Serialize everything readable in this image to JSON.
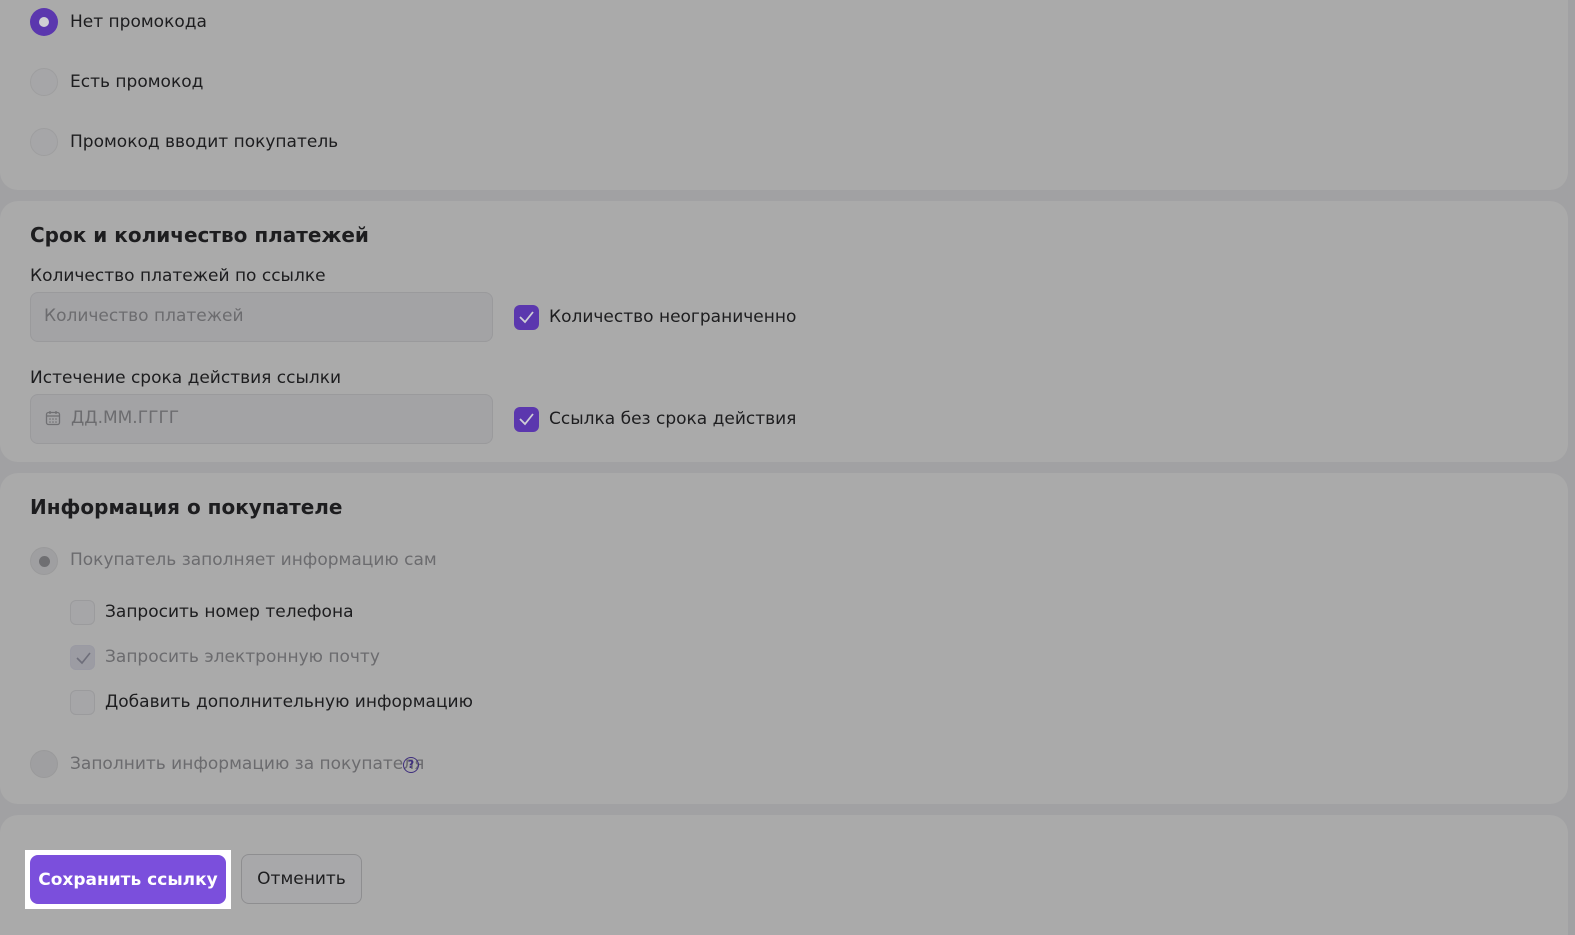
{
  "promo": {
    "options": [
      {
        "label": "Нет промокода",
        "selected": true
      },
      {
        "label": "Есть промокод",
        "selected": false
      },
      {
        "label": "Промокод вводит покупатель",
        "selected": false
      }
    ]
  },
  "term": {
    "title": "Срок и количество платежей",
    "count_label": "Количество платежей по ссылке",
    "count_placeholder": "Количество платежей",
    "count_unlimited_label": "Количество неограниченно",
    "count_unlimited_checked": true,
    "expiry_label": "Истечение срока действия ссылки",
    "expiry_placeholder": "ДД.ММ.ГГГГ",
    "no_expiry_label": "Ссылка без срока действия",
    "no_expiry_checked": true
  },
  "buyer": {
    "title": "Информация о покупателе",
    "self_fill_label": "Покупатель заполняет информацию сам",
    "options": [
      {
        "label": "Запросить номер телефона",
        "checked": false
      },
      {
        "label": "Запросить электронную почту",
        "checked": true
      },
      {
        "label": "Добавить дополнительную информацию",
        "checked": false
      }
    ],
    "fill_for_buyer_label": "Заполнить информацию за покупателя"
  },
  "actions": {
    "save_label": "Сохранить ссылку",
    "cancel_label": "Отменить"
  },
  "colors": {
    "accent": "#5b37ae",
    "primary_button": "#7b4fdc",
    "overlay_bg": "#a1a1a3"
  }
}
